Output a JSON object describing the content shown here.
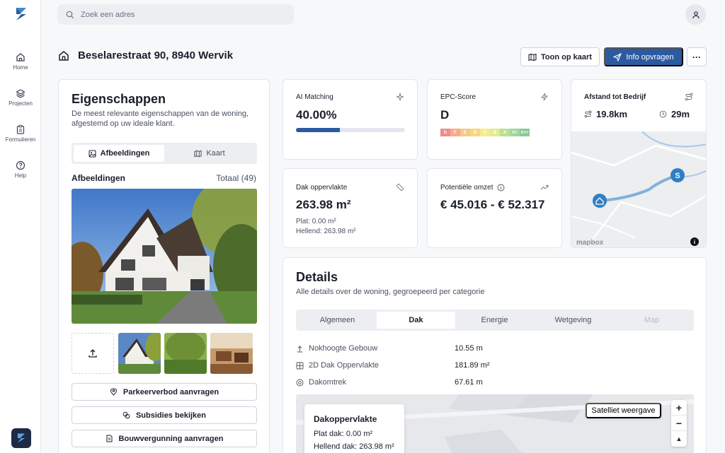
{
  "search": {
    "placeholder": "Zoek een adres"
  },
  "sidebar": {
    "items": [
      {
        "label": "Home"
      },
      {
        "label": "Projecten"
      },
      {
        "label": "Formulieren"
      },
      {
        "label": "Help"
      }
    ]
  },
  "header": {
    "address": "Beselarestraat 90, 8940 Wervik",
    "show_on_map": "Toon op kaart",
    "request_info": "Info opvragen",
    "more": "···"
  },
  "properties": {
    "title": "Eigenschappen",
    "description": "De meest relevante eigenschappen van de woning, afgestemd op uw ideale klant.",
    "tabs": [
      "Afbeeldingen",
      "Kaart"
    ],
    "images_label": "Afbeeldingen",
    "images_total": "Totaal (49)",
    "actions": [
      "Parkeerverbod aanvragen",
      "Subsidies bekijken",
      "Bouwvergunning aanvragen"
    ]
  },
  "ai_matching": {
    "label": "AI Matching",
    "value": "40.00%",
    "progress": 0.4
  },
  "epc": {
    "label": "EPC-Score",
    "value": "D",
    "scale": [
      "G",
      "F",
      "E",
      "D",
      "C",
      "B",
      "A",
      "A+",
      "A++"
    ],
    "colors": [
      "#e4302b",
      "#ee6b2c",
      "#f29a2e",
      "#f2b31b",
      "#f2dd2a",
      "#c9dc3a",
      "#8cc63f",
      "#57b848",
      "#2f9e44"
    ]
  },
  "distance": {
    "label": "Afstand tot Bedrijf",
    "km": "19.8km",
    "time": "29m"
  },
  "roof": {
    "label": "Dak oppervlakte",
    "value": "263.98 m²",
    "flat": "Plat: 0.00 m²",
    "sloped": "Hellend: 263.98 m²"
  },
  "revenue": {
    "label": "Potentiële omzet",
    "value": "€ 45.016 - € 52.317"
  },
  "details": {
    "title": "Details",
    "description": "Alle details over de woning, gegroepeerd per categorie",
    "tabs": [
      "Algemeen",
      "Dak",
      "Energie",
      "Wetgeving",
      "Map"
    ],
    "rows": [
      {
        "label": "Nokhoogte Gebouw",
        "value": "10.55 m"
      },
      {
        "label": "2D Dak Oppervlakte",
        "value": "181.89 m²"
      },
      {
        "label": "Dakomtrek",
        "value": "67.61 m"
      }
    ],
    "map_box": {
      "title": "Dakoppervlakte",
      "flat": "Plat dak: 0.00 m²",
      "sloped": "Hellend dak: 263.98 m²"
    },
    "satellite": "Satelliet weergave"
  },
  "map": {
    "attribution": "mapbox",
    "marker_label": "S"
  },
  "colors": {
    "primary": "#2c5aa0",
    "accent": "#3f8ccc"
  }
}
